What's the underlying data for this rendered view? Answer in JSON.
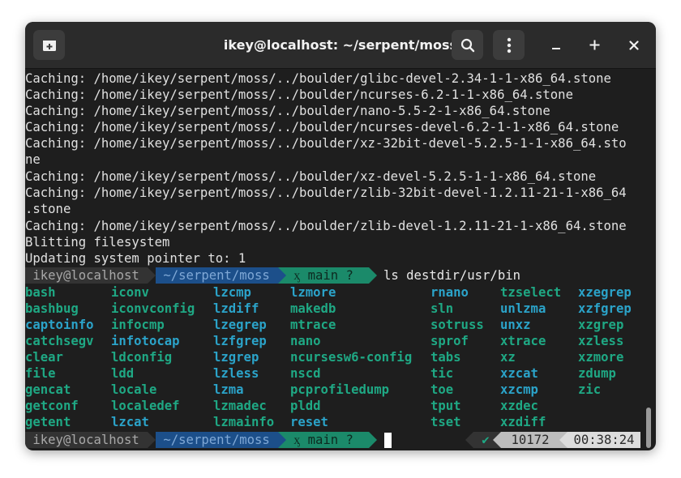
{
  "window": {
    "title": "ikey@localhost: ~/serpent/moss",
    "icons": [
      "new-tab-icon",
      "search-icon",
      "kebab-menu-icon",
      "minimize-icon",
      "maximize-icon",
      "close-icon"
    ]
  },
  "output_lines": [
    "Caching: /home/ikey/serpent/moss/../boulder/glibc-devel-2.34-1-1-x86_64.stone",
    "Caching: /home/ikey/serpent/moss/../boulder/ncurses-6.2-1-1-x86_64.stone",
    "Caching: /home/ikey/serpent/moss/../boulder/nano-5.5-2-1-x86_64.stone",
    "Caching: /home/ikey/serpent/moss/../boulder/ncurses-devel-6.2-1-1-x86_64.stone",
    "Caching: /home/ikey/serpent/moss/../boulder/xz-32bit-devel-5.2.5-1-1-x86_64.sto",
    "ne",
    "Caching: /home/ikey/serpent/moss/../boulder/xz-devel-5.2.5-1-1-x86_64.stone",
    "Caching: /home/ikey/serpent/moss/../boulder/zlib-32bit-devel-1.2.11-21-1-x86_64",
    ".stone",
    "Caching: /home/ikey/serpent/moss/../boulder/zlib-devel-1.2.11-21-1-x86_64.stone",
    "Blitting filesystem",
    "Updating system pointer to: 1"
  ],
  "prompt": {
    "user": " ikey@localhost ",
    "dir": " ~/serpent/moss ",
    "git": " ᶍ main ? ",
    "command": "ls destdir/usr/bin"
  },
  "ls_rows": [
    [
      "bash",
      "iconv",
      "lzcmp",
      "lzmore",
      "rnano",
      "tzselect",
      "xzegrep"
    ],
    [
      "bashbug",
      "iconvconfig",
      "lzdiff",
      "makedb",
      "sln",
      "unlzma",
      "xzfgrep"
    ],
    [
      "captoinfo",
      "infocmp",
      "lzegrep",
      "mtrace",
      "sotruss",
      "unxz",
      "xzgrep"
    ],
    [
      "catchsegv",
      "infotocap",
      "lzfgrep",
      "nano",
      "sprof",
      "xtrace",
      "xzless"
    ],
    [
      "clear",
      "ldconfig",
      "lzgrep",
      "ncursesw6-config",
      "tabs",
      "xz",
      "xzmore"
    ],
    [
      "file",
      "ldd",
      "lzless",
      "nscd",
      "tic",
      "xzcat",
      "zdump"
    ],
    [
      "gencat",
      "locale",
      "lzma",
      "pcprofiledump",
      "toe",
      "xzcmp",
      "zic"
    ],
    [
      "getconf",
      "localedef",
      "lzmadec",
      "pldd",
      "tput",
      "xzdec",
      ""
    ],
    [
      "getent",
      "lzcat",
      "lzmainfo",
      "reset",
      "tset",
      "xzdiff",
      ""
    ]
  ],
  "ls_links": [
    "captoinfo",
    "infotocap",
    "lzcat",
    "lzcmp",
    "lzdiff",
    "lzegrep",
    "lzfgrep",
    "lzgrep",
    "lzless",
    "lzma",
    "lzmore",
    "reset",
    "rnano",
    "unlzma",
    "unxz",
    "xzcat",
    "xzcmp",
    "xzegrep",
    "xzfgrep"
  ],
  "status": {
    "check": "✔",
    "history": "10172",
    "time": "00:38:24"
  },
  "colors": {
    "background": "#1e1e1e",
    "executable": "#1fa884",
    "symlink": "#2ba3c9",
    "prompt_dir": "#1c4f8a",
    "prompt_git": "#1b8a6a"
  }
}
